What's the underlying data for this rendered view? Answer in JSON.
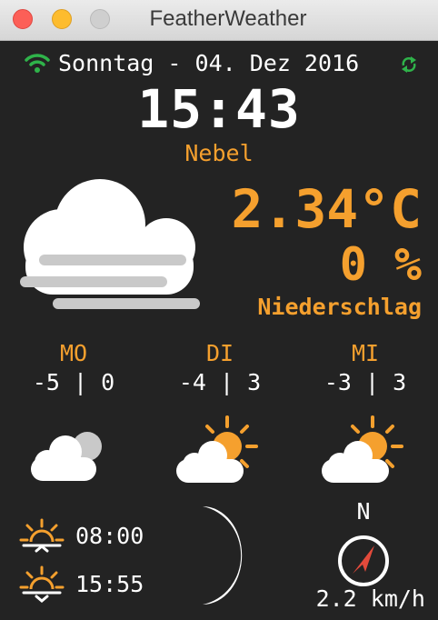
{
  "window": {
    "title": "FeatherWeather"
  },
  "status": {
    "date": "Sonntag - 04. Dez 2016",
    "time": "15:43",
    "wifi_icon": "wifi-icon",
    "sync_icon": "sync-icon"
  },
  "current": {
    "condition": "Nebel",
    "icon": "fog-icon",
    "temperature": "2.34°C",
    "precipitation": "0 %",
    "precipitation_label": "Niederschlag"
  },
  "forecast": [
    {
      "day": "MO",
      "range": "-5 | 0",
      "icon": "cloudy-icon"
    },
    {
      "day": "DI",
      "range": "-4 | 3",
      "icon": "partly-sunny-icon"
    },
    {
      "day": "MI",
      "range": "-3 | 3",
      "icon": "partly-sunny-icon"
    }
  ],
  "sun": {
    "sunrise": "08:00",
    "sunset": "15:55"
  },
  "moon": {
    "icon": "moon-phase-icon"
  },
  "wind": {
    "direction": "N",
    "speed": "2.2 km/h"
  },
  "colors": {
    "accent": "#f5a02e",
    "background": "#232323",
    "wifi": "#2fb34a",
    "compass_needle": "#e24a3b"
  }
}
